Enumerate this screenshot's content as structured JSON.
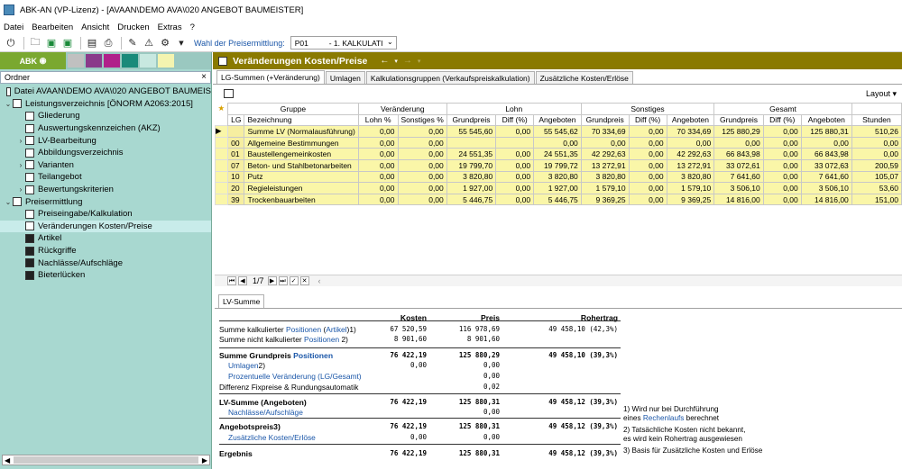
{
  "window": {
    "title": "ABK-AN (VP-Lizenz) - [AVAAN\\DEMO AVA\\020 ANGEBOT BAUMEISTER]"
  },
  "menu": [
    "Datei",
    "Bearbeiten",
    "Ansicht",
    "Drucken",
    "Extras",
    "?"
  ],
  "toolbar": {
    "price_label": "Wahl der Preisermittlung:",
    "price_code": "P01",
    "price_value": "- 1. KALKULATI"
  },
  "left": {
    "brand": "ABK",
    "header": "Ordner",
    "close": "×",
    "swatches": [
      "#c0c0c0",
      "#8a3a8a",
      "#b0208a",
      "#1a8a7a",
      "#c8e8e0",
      "#f4f4b0"
    ],
    "tree": [
      {
        "label": "Datei AVAAN\\DEMO AVA\\020 ANGEBOT BAUMEIS",
        "level": 0,
        "tw": ""
      },
      {
        "label": "Leistungsverzeichnis [ÖNORM A2063:2015]",
        "level": 0,
        "tw": "⌄"
      },
      {
        "label": "Gliederung",
        "level": 1,
        "tw": ""
      },
      {
        "label": "Auswertungskennzeichen (AKZ)",
        "level": 1,
        "tw": ""
      },
      {
        "label": "LV-Bearbeitung",
        "level": 1,
        "tw": "›"
      },
      {
        "label": "Abbildungsverzeichnis",
        "level": 1,
        "tw": ""
      },
      {
        "label": "Varianten",
        "level": 1,
        "tw": "›"
      },
      {
        "label": "Teilangebot",
        "level": 1,
        "tw": ""
      },
      {
        "label": "Bewertungskriterien",
        "level": 1,
        "tw": "›"
      },
      {
        "label": "Preisermittlung",
        "level": 0,
        "tw": "⌄"
      },
      {
        "label": "Preiseingabe/Kalkulation",
        "level": 1,
        "tw": ""
      },
      {
        "label": "Veränderungen Kosten/Preise",
        "level": 1,
        "tw": "",
        "selected": true
      },
      {
        "label": "Artikel",
        "level": 1,
        "tw": ""
      },
      {
        "label": "Rückgriffe",
        "level": 1,
        "tw": ""
      },
      {
        "label": "Nachlässe/Aufschläge",
        "level": 1,
        "tw": ""
      },
      {
        "label": "Bieterlücken",
        "level": 1,
        "tw": ""
      }
    ]
  },
  "right": {
    "title": "Veränderungen Kosten/Preise",
    "tabs": [
      "LG-Summen (+Veränderung)",
      "Umlagen",
      "Kalkulationsgruppen (Verkaufspreiskalkulation)",
      "Zusätzliche Kosten/Erlöse"
    ],
    "layout_label": "Layout",
    "grid": {
      "group_headers": [
        "Gruppe",
        "Veränderung",
        "Lohn",
        "Sonstiges",
        "Gesamt"
      ],
      "columns": [
        "LG",
        "Bezeichnung",
        "Lohn %",
        "Sonstiges %",
        "Grundpreis",
        "Diff (%)",
        "Angeboten",
        "Grundpreis",
        "Diff (%)",
        "Angeboten",
        "Grundpreis",
        "Diff (%)",
        "Angeboten",
        "Stunden"
      ],
      "rows": [
        [
          "",
          "Summe LV (Normalausführung)",
          "0,00",
          "0,00",
          "55 545,60",
          "0,00",
          "55 545,62",
          "70 334,69",
          "0,00",
          "70 334,69",
          "125 880,29",
          "0,00",
          "125 880,31",
          "510,26"
        ],
        [
          "00",
          "Allgemeine Bestimmungen",
          "0,00",
          "0,00",
          "",
          "",
          "0,00",
          "0,00",
          "0,00",
          "0,00",
          "0,00",
          "0,00",
          "0,00",
          "0,00"
        ],
        [
          "01",
          "Baustellengemeinkosten",
          "0,00",
          "0,00",
          "24 551,35",
          "0,00",
          "24 551,35",
          "42 292,63",
          "0,00",
          "42 292,63",
          "66 843,98",
          "0,00",
          "66 843,98",
          "0,00"
        ],
        [
          "07",
          "Beton- und Stahlbetonarbeiten",
          "0,00",
          "0,00",
          "19 799,70",
          "0,00",
          "19 799,72",
          "13 272,91",
          "0,00",
          "13 272,91",
          "33 072,61",
          "0,00",
          "33 072,63",
          "200,59"
        ],
        [
          "10",
          "Putz",
          "0,00",
          "0,00",
          "3 820,80",
          "0,00",
          "3 820,80",
          "3 820,80",
          "0,00",
          "3 820,80",
          "7 641,60",
          "0,00",
          "7 641,60",
          "105,07"
        ],
        [
          "20",
          "Regieleistungen",
          "0,00",
          "0,00",
          "1 927,00",
          "0,00",
          "1 927,00",
          "1 579,10",
          "0,00",
          "1 579,10",
          "3 506,10",
          "0,00",
          "3 506,10",
          "53,60"
        ],
        [
          "39",
          "Trockenbauarbeiten",
          "0,00",
          "0,00",
          "5 446,75",
          "0,00",
          "5 446,75",
          "9 369,25",
          "0,00",
          "9 369,25",
          "14 816,00",
          "0,00",
          "14 816,00",
          "151,00"
        ]
      ]
    },
    "pager": {
      "page": "1/7"
    },
    "bottom_tab": "LV-Summe",
    "summary": {
      "headers": [
        "Kosten",
        "Preis",
        "Rohertrag"
      ],
      "rows": [
        {
          "label_a": "Summe kalkulierter ",
          "label_link": "Positionen",
          "label_b": " (",
          "label_link2": "Artikel",
          "label_c": ")1)",
          "c1": "67 520,59",
          "c2": "116 978,69",
          "c3": "49 458,10 (42,3%)"
        },
        {
          "label_a": "Summe nicht kalkulierter ",
          "label_link": "Positionen",
          "label_b": " 2)",
          "c1": "8 901,60",
          "c2": "8 901,60",
          "c3": ""
        },
        {
          "label_a": "Summe Grundpreis ",
          "label_link": "Positionen",
          "c1": "76 422,19",
          "c2": "125 880,29",
          "c3": "49 458,10 (39,3%)"
        },
        {
          "label_link": "Umlagen",
          "label_b": "2)",
          "c1": "0,00",
          "c2": "0,00",
          "c3": ""
        },
        {
          "label_link": "Prozentuelle Veränderung (LG/Gesamt)",
          "c1": "",
          "c2": "0,00",
          "c3": ""
        },
        {
          "label_a": "Differenz Fixpreise & Rundungsautomatik",
          "c1": "",
          "c2": "0,02",
          "c3": ""
        },
        {
          "label_a": "LV-Summe (Angeboten)",
          "c1": "76 422,19",
          "c2": "125 880,31",
          "c3": "49 458,12 (39,3%)"
        },
        {
          "label_link": "Nachlässe/Aufschläge",
          "c1": "",
          "c2": "0,00",
          "c3": ""
        },
        {
          "label_a": "Angebotspreis",
          "label_b": "3)",
          "c1": "76 422,19",
          "c2": "125 880,31",
          "c3": "49 458,12 (39,3%)"
        },
        {
          "label_link": "Zusätzliche Kosten/Erlöse",
          "c1": "0,00",
          "c2": "0,00",
          "c3": ""
        },
        {
          "label_a": "Ergebnis",
          "c1": "76 422,19",
          "c2": "125 880,31",
          "c3": "49 458,12 (39,3%)"
        }
      ]
    },
    "notes": {
      "n1a": "1) Wird nur bei Durchführung",
      "n1b": "eines ",
      "n1link": "Rechenlaufs",
      "n1c": " berechnet",
      "n2a": "2) Tatsächliche Kosten nicht bekannt,",
      "n2b": "es wird kein Rohertrag ausgewiesen",
      "n3": "3) Basis für Zusätzliche Kosten und Erlöse"
    }
  }
}
